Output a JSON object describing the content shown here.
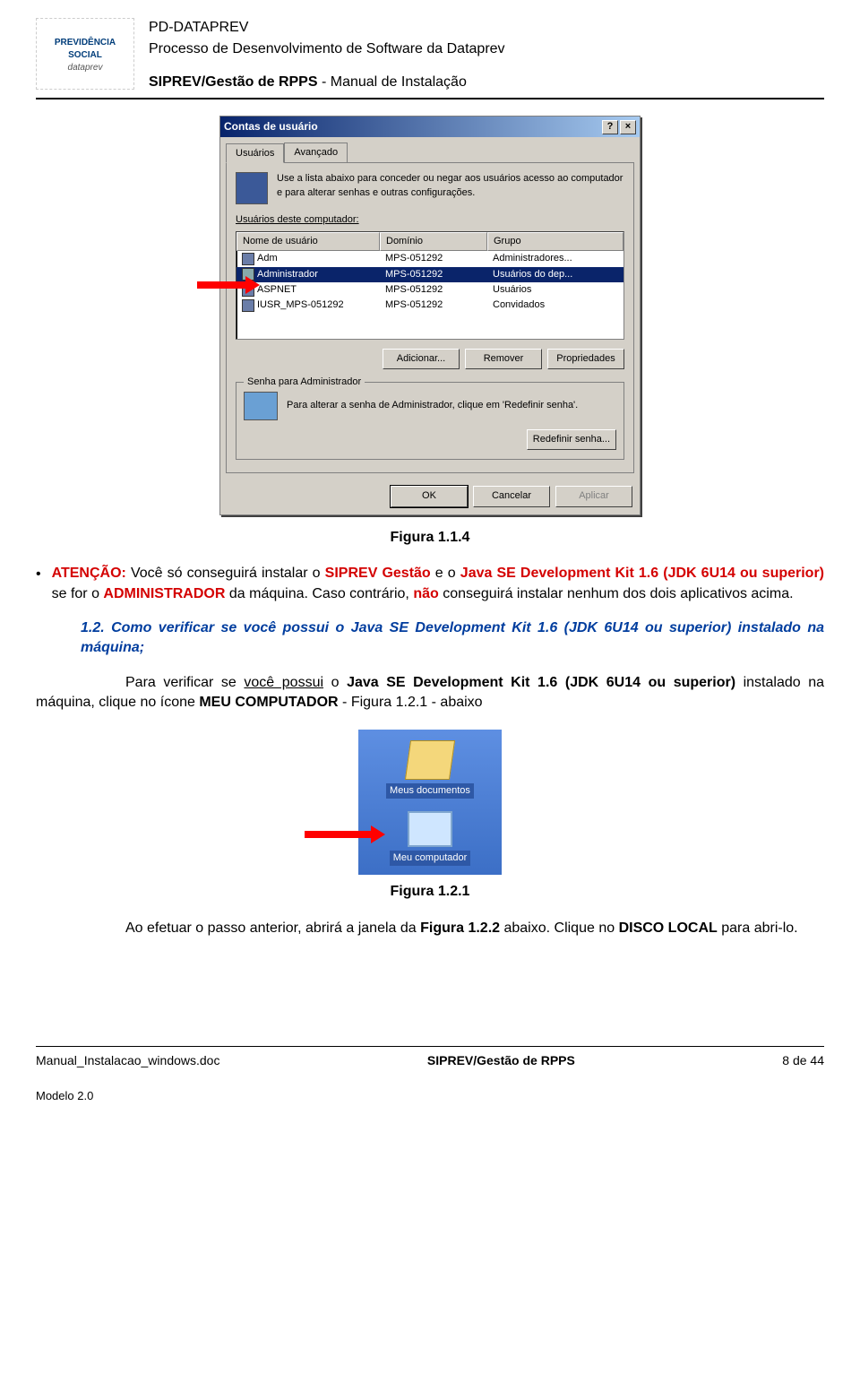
{
  "header": {
    "logo_line1": "",
    "logo_line2": "PREVIDÊNCIA SOCIAL",
    "logo_line3": "dataprev",
    "line1": "PD-DATAPREV",
    "line2": "Processo de Desenvolvimento de Software da Dataprev",
    "line3_bold": "SIPREV/Gestão de RPPS",
    "line3_tail": " - Manual de Instalação"
  },
  "dialog": {
    "title": "Contas de usuário",
    "help_btn": "?",
    "close_btn": "×",
    "tab_users": "Usuários",
    "tab_adv": "Avançado",
    "instruction": "Use a lista abaixo para conceder ou negar aos usuários acesso ao computador e para alterar senhas e outras configurações.",
    "list_label": "Usuários deste computador:",
    "cols": {
      "name": "Nome de usuário",
      "domain": "Domínio",
      "group": "Grupo"
    },
    "rows": [
      {
        "name": "Adm",
        "domain": "MPS-051292",
        "group": "Administradores..."
      },
      {
        "name": "Administrador",
        "domain": "MPS-051292",
        "group": "Usuários do dep..."
      },
      {
        "name": "ASPNET",
        "domain": "MPS-051292",
        "group": "Usuários"
      },
      {
        "name": "IUSR_MPS-051292",
        "domain": "MPS-051292",
        "group": "Convidados"
      }
    ],
    "btn_add": "Adicionar...",
    "btn_remove": "Remover",
    "btn_props": "Propriedades",
    "pw_group_title": "Senha para Administrador",
    "pw_text": "Para alterar a senha de Administrador, clique em 'Redefinir senha'.",
    "btn_reset_pw": "Redefinir senha...",
    "btn_ok": "OK",
    "btn_cancel": "Cancelar",
    "btn_apply": "Aplicar"
  },
  "fig114": "Figura 1.1.4",
  "p1": {
    "lead": "ATENÇÃO:",
    "t1": " Você só conseguirá instalar o ",
    "red1": "SIPREV Gestão",
    "t2": " e o ",
    "red2": "Java SE Development Kit 1.6 (JDK 6U14 ou superior)",
    "t3": " se for o ",
    "red3": "ADMINISTRADOR",
    "t4": " da máquina. Caso contrário, ",
    "red4": "não",
    "t5": " conseguirá instalar nenhum dos dois aplicativos acima."
  },
  "p2": {
    "num": "1.2.",
    "t1": " Como verificar se você possui o Java SE Development Kit 1.6 (JDK 6U14 ou superior) instalado na máquina;"
  },
  "p3": {
    "t1": "Para verificar se ",
    "u1": "você possui",
    "t2": " o ",
    "b1": "Java SE Development Kit 1.6 (JDK 6U14 ou superior)",
    "t3": " instalado na máquina, clique no ícone ",
    "b2": "MEU COMPUTADOR",
    "t4": " - Figura 1.2.1 - abaixo"
  },
  "desktop": {
    "docs": "Meus documentos",
    "pc": "Meu computador"
  },
  "fig121": "Figura 1.2.1",
  "p4": {
    "t1": "Ao efetuar o passo anterior, abrirá a janela da ",
    "b1": "Figura 1.2.2",
    "t2": " abaixo. Clique no ",
    "b2": "DISCO LOCAL",
    "t3": " para abri-lo."
  },
  "footer": {
    "left": "Manual_Instalacao_windows.doc",
    "mid": "SIPREV/Gestão de RPPS",
    "right": "8 de 44",
    "model": "Modelo 2.0"
  }
}
